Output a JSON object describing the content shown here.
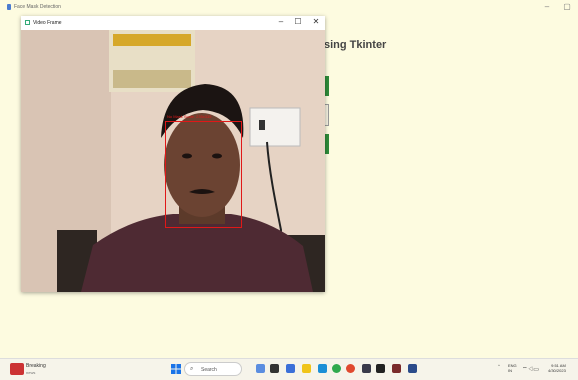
{
  "app": {
    "title": "Face Mask Detection",
    "minimize": "–",
    "restore": "▢",
    "heading": "sing Tkinter"
  },
  "video_window": {
    "title": "Video Frame",
    "minimize": "–",
    "maximize": "☐",
    "close": "✕",
    "detection_label": "No Mask   Scale: 235x335"
  },
  "taskbar": {
    "news_title": "Breaking",
    "news_sub": "news",
    "search_placeholder": "Search",
    "lang": "ENG",
    "region": "IN",
    "time": "9:51 AM",
    "date": "4/30/2023"
  }
}
